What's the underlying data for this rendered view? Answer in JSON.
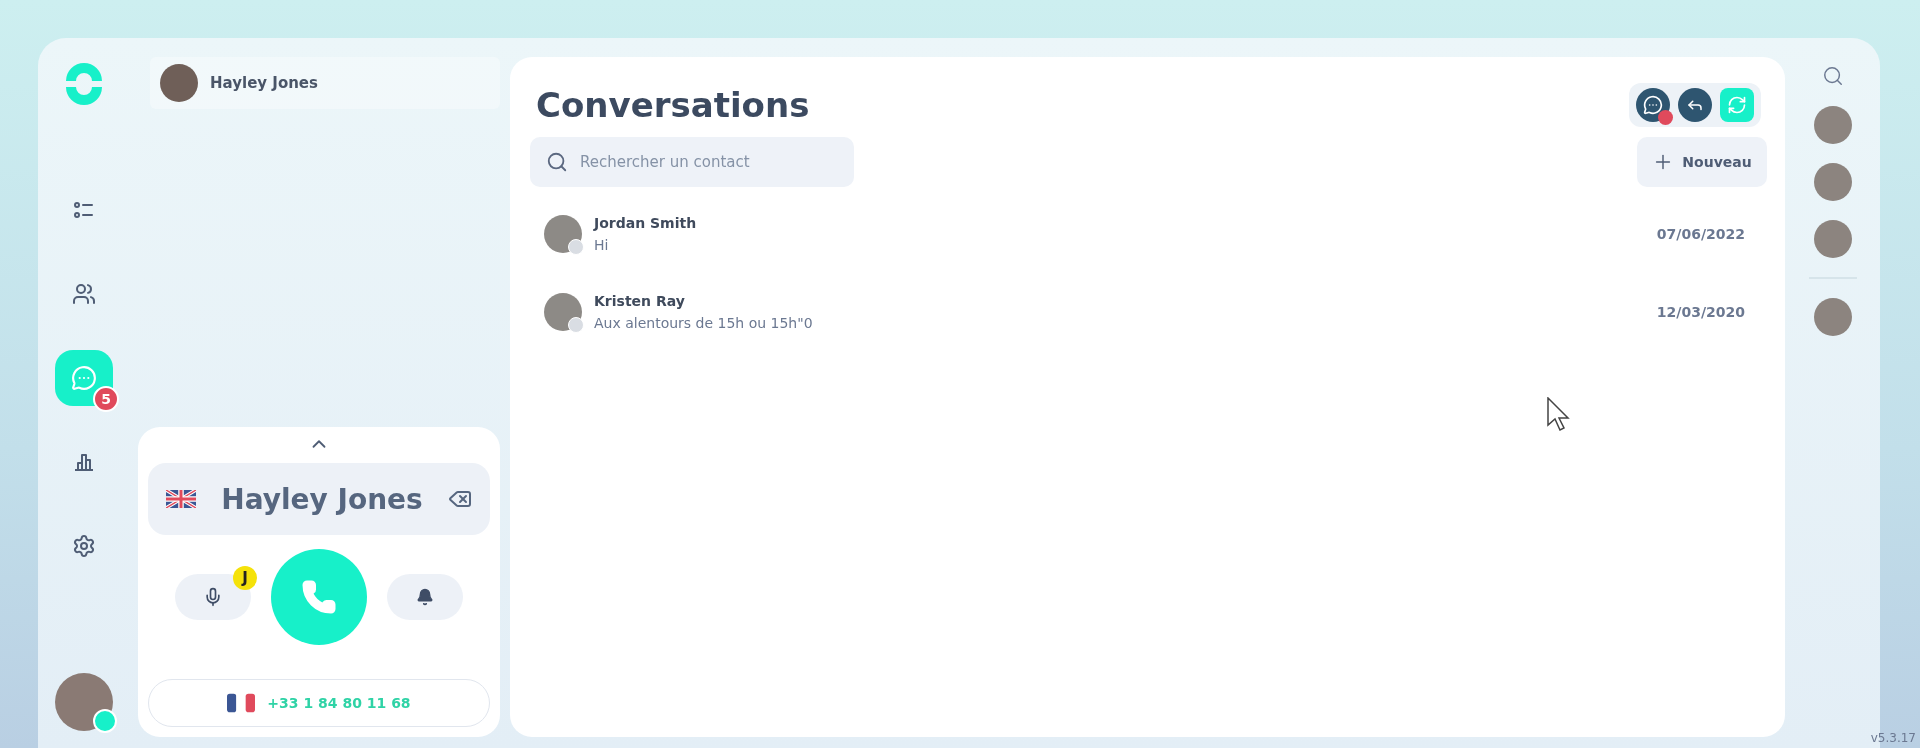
{
  "nav": {
    "items": [
      {
        "kind": "tasks",
        "selected": false
      },
      {
        "kind": "contacts",
        "selected": false
      },
      {
        "kind": "conversations",
        "selected": true,
        "badge": "5"
      },
      {
        "kind": "stats",
        "selected": false
      },
      {
        "kind": "settings",
        "selected": false
      }
    ],
    "user": {
      "online": true
    }
  },
  "contact_header": {
    "name": "Hayley Jones"
  },
  "dialer": {
    "name": "Hayley Jones",
    "mic_badge": "J",
    "number": "+33 1 84 80 11 68"
  },
  "main": {
    "title": "Conversations",
    "actions": [
      {
        "kind": "messages",
        "selected": false,
        "alert": true
      },
      {
        "kind": "reply",
        "selected": false,
        "alert": false
      },
      {
        "kind": "sync",
        "selected": true,
        "alert": false
      }
    ],
    "search": {
      "placeholder": "Rechercher un contact"
    },
    "new_button": "Nouveau",
    "conversations": [
      {
        "name": "Jordan Smith",
        "message": "Hi",
        "date": "07/06/2022"
      },
      {
        "name": "Kristen Ray",
        "message": "Aux alentours de 15h ou 15h\"0",
        "date": "12/03/2020"
      }
    ]
  },
  "version": "v5.3.17"
}
